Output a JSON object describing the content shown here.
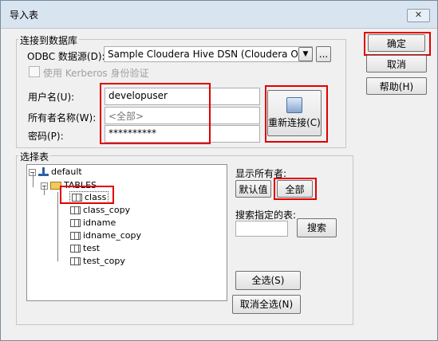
{
  "window": {
    "title": "导入表",
    "close_glyph": "✕"
  },
  "connection": {
    "legend": "连接到数据库",
    "odbc_label": "ODBC 数据源(D):",
    "odbc_value": "Sample Cloudera Hive DSN (Cloudera ODBC Driver",
    "browse_label": "...",
    "kerberos_label": "使用 Kerberos 身份验证",
    "user_label": "用户名(U):",
    "user_value": "developuser",
    "owner_label": "所有者名称(W):",
    "owner_value": "<全部>",
    "password_label": "密码(P):",
    "password_value": "**********",
    "reconnect_label": "重新连接(C)"
  },
  "buttons": {
    "ok": "确定",
    "cancel": "取消",
    "help": "帮助(H)"
  },
  "select_tables": {
    "legend": "选择表",
    "tree": {
      "root": "default",
      "folder": "TABLES",
      "tables": [
        "class",
        "class_copy",
        "idname",
        "idname_copy",
        "test",
        "test_copy"
      ]
    },
    "show_owners_label": "显示所有者:",
    "default_button": "默认值",
    "all_button": "全部",
    "search_label": "搜索指定的表:",
    "search_button": "搜索",
    "select_all_button": "全选(S)",
    "deselect_all_button": "取消全选(N)"
  },
  "colors": {
    "highlight_border": "#e00000",
    "tree_line": "#7f7f7f"
  }
}
